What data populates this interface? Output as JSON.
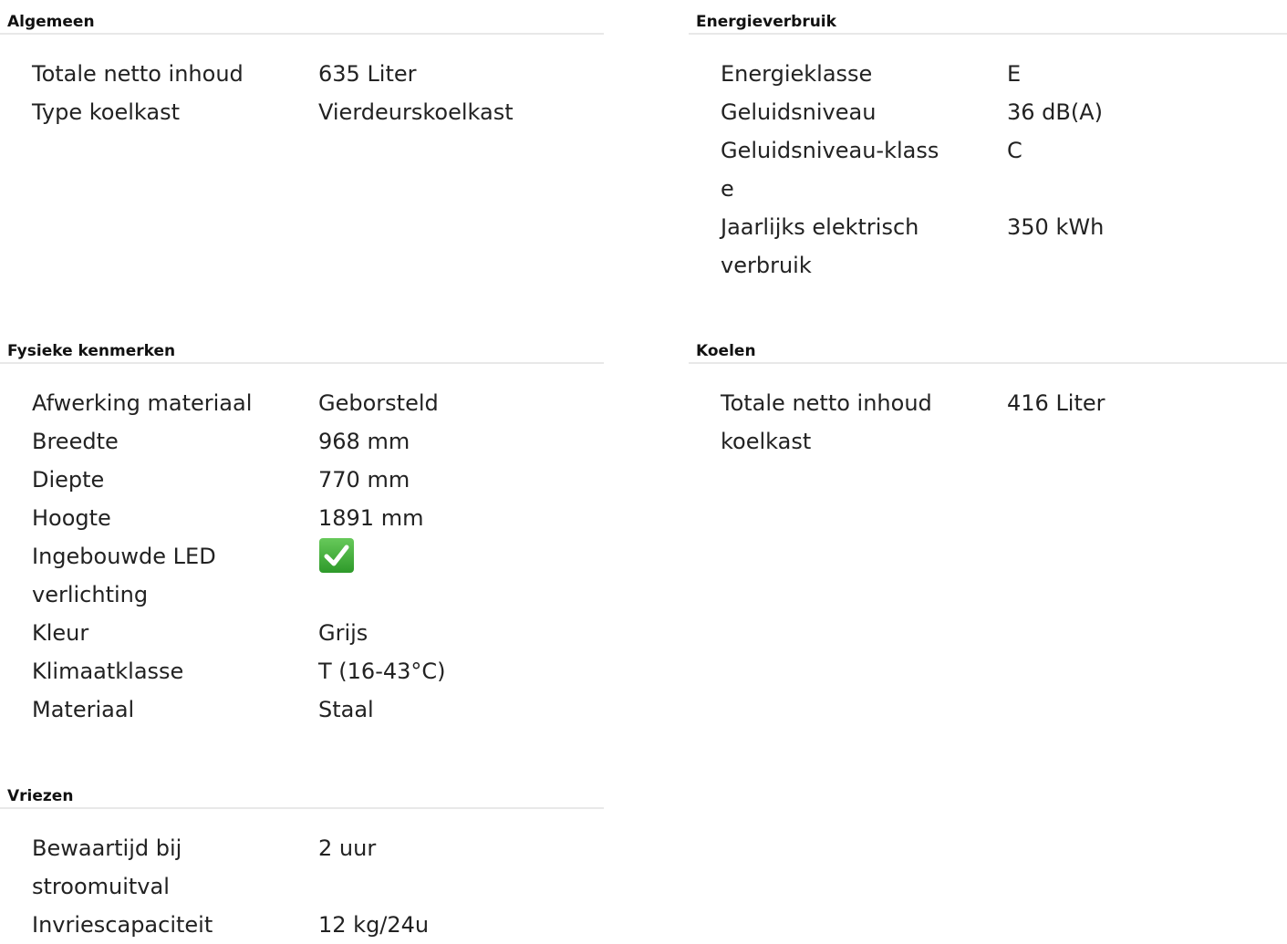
{
  "sections": {
    "algemeen": {
      "title": "Algemeen",
      "rows": [
        {
          "label": "Totale netto inhoud",
          "value": "635 Liter"
        },
        {
          "label": "Type koelkast",
          "value": "Vierdeurskoelkast"
        }
      ]
    },
    "energieverbruik": {
      "title": "Energieverbruik",
      "rows": [
        {
          "label": "Energieklasse",
          "value": "E"
        },
        {
          "label": "Geluidsniveau",
          "value": "36 dB(A)"
        },
        {
          "label": "Geluidsniveau-klass e",
          "value": "C"
        },
        {
          "label": "Jaarlijks elektrisch verbruik",
          "value": "350 kWh"
        }
      ]
    },
    "fysieke_kenmerken": {
      "title": "Fysieke kenmerken",
      "rows": [
        {
          "label": "Afwerking materiaal",
          "value": "Geborsteld"
        },
        {
          "label": "Breedte",
          "value": "968 mm"
        },
        {
          "label": "Diepte",
          "value": "770 mm"
        },
        {
          "label": "Hoogte",
          "value": "1891 mm"
        },
        {
          "label": "Ingebouwde LED verlichting",
          "value": "",
          "icon": "checkmark-icon"
        },
        {
          "label": "Kleur",
          "value": "Grijs"
        },
        {
          "label": "Klimaatklasse",
          "value": "T (16-43°C)"
        },
        {
          "label": "Materiaal",
          "value": "Staal"
        }
      ]
    },
    "koelen": {
      "title": "Koelen",
      "rows": [
        {
          "label": "Totale netto inhoud koelkast",
          "value": "416 Liter"
        }
      ]
    },
    "vriezen": {
      "title": "Vriezen",
      "rows": [
        {
          "label": "Bewaartijd bij stroomuitval",
          "value": "2 uur"
        },
        {
          "label": "Invriescapaciteit",
          "value": "12 kg/24u"
        }
      ]
    }
  },
  "colors": {
    "check_green": "#3fae3a",
    "divider": "#e8e8e8"
  }
}
